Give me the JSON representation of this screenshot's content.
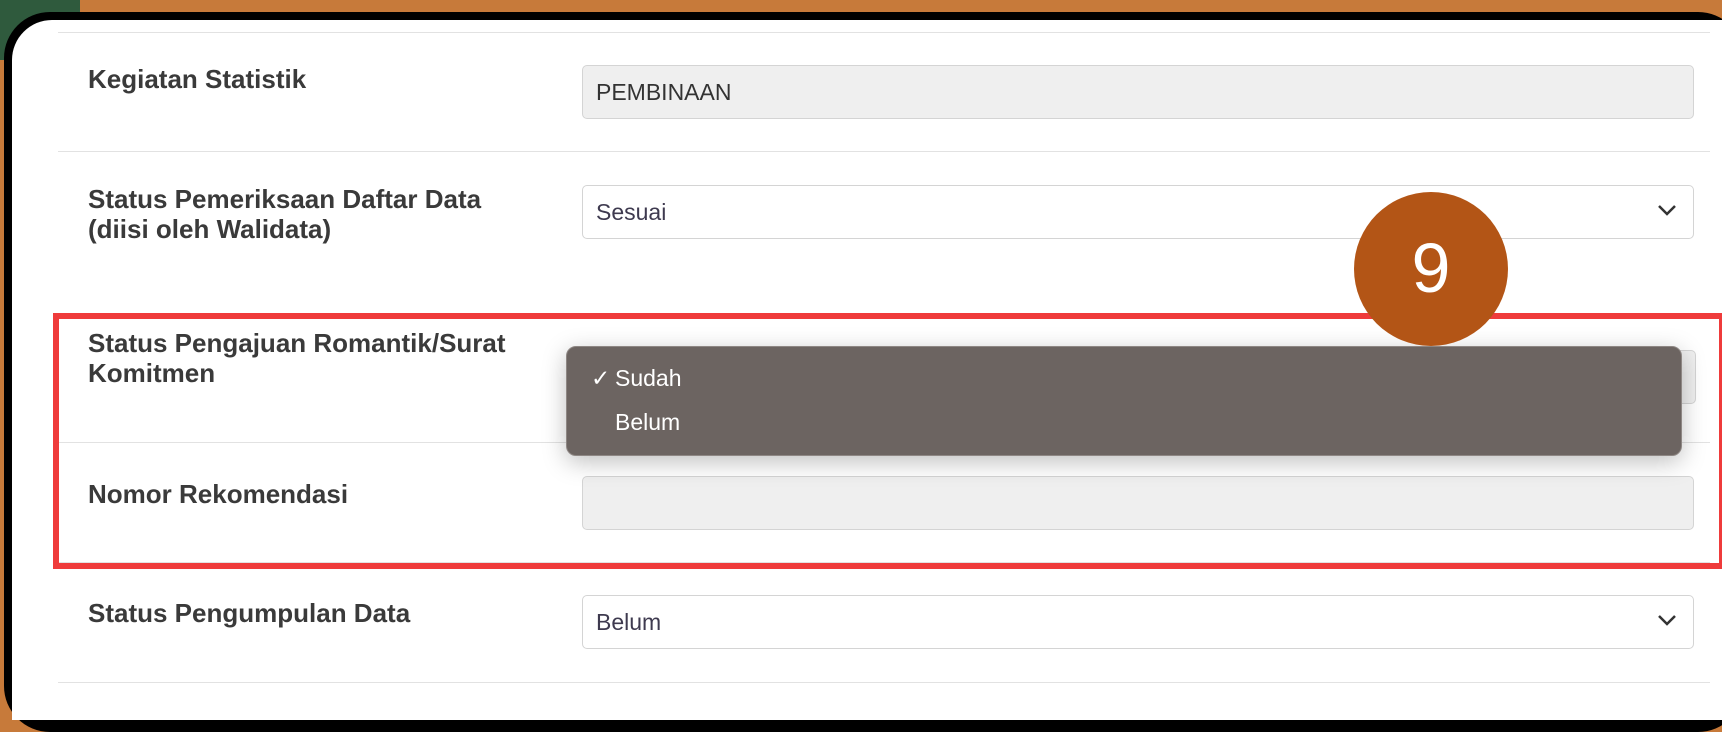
{
  "form": {
    "rows": [
      {
        "label": "Kegiatan Statistik",
        "value": "PEMBINAAN",
        "type": "readonly"
      },
      {
        "label_line1": "Status Pemeriksaan Daftar Data",
        "label_line2": "(diisi oleh Walidata)",
        "value": "Sesuai",
        "type": "select"
      },
      {
        "label_line1": "Status Pengajuan Romantik/Surat",
        "label_line2": "Komitmen",
        "type": "select-open"
      },
      {
        "label": "Nomor Rekomendasi",
        "value": "",
        "type": "readonly"
      },
      {
        "label": "Status Pengumpulan Data",
        "value": "Belum",
        "type": "select"
      }
    ]
  },
  "dropdown": {
    "options": [
      {
        "label": "Sudah",
        "selected": true,
        "check": "✓"
      },
      {
        "label": "Belum",
        "selected": false,
        "check": ""
      }
    ]
  },
  "annotation": {
    "step_number": "9",
    "step_color": "#b35516",
    "highlight_color": "#ef3b3b"
  },
  "icons": {
    "select_arrow": "chevron-down-icon"
  }
}
